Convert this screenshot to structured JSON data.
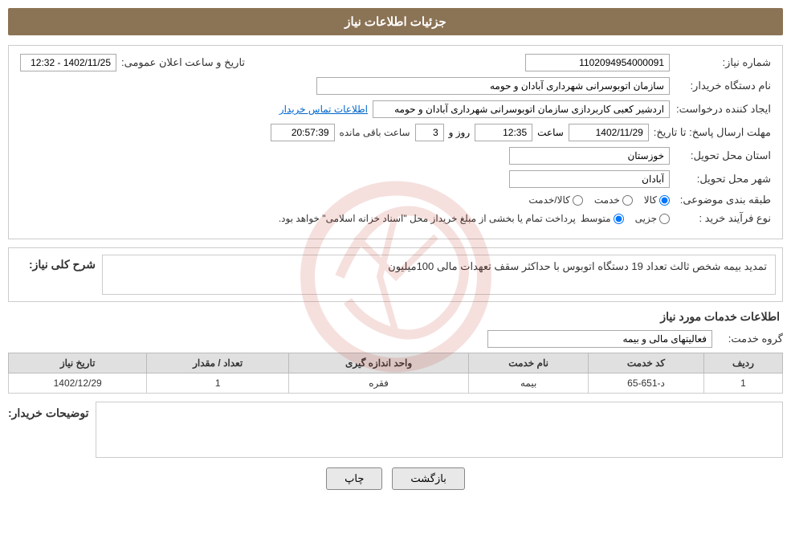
{
  "header": {
    "title": "جزئیات اطلاعات نیاز"
  },
  "fields": {
    "shomara_niaz_label": "شماره نیاز:",
    "shomara_niaz_value": "1102094954000091",
    "tarikh_label": "تاریخ و ساعت اعلان عمومی:",
    "tarikh_value": "1402/11/25 - 12:32",
    "nam_dastgah_label": "نام دستگاه خریدار:",
    "nam_dastgah_value": "سازمان اتوبوسرانی شهرداری آبادان و حومه",
    "ijad_label": "ایجاد کننده درخواست:",
    "ijad_value": "اردشیر کعبی کاربردازی سازمان اتوبوسرانی شهرداری آبادان و حومه",
    "etela_tamaslink": "اطلاعات تماس خریدار",
    "mohlat_label": "مهلت ارسال پاسخ: تا تاریخ:",
    "mohlat_date": "1402/11/29",
    "mohlat_time_label": "ساعت",
    "mohlat_time": "12:35",
    "mohlat_roz_label": "روز و",
    "mohlat_roz_value": "3",
    "mohlat_remaining_label": "ساعت باقی مانده",
    "mohlat_remaining_time": "20:57:39",
    "ostan_label": "استان محل تحویل:",
    "ostan_value": "خوزستان",
    "shahr_label": "شهر محل تحویل:",
    "shahr_value": "آبادان",
    "tabaqe_label": "طبقه بندی موضوعی:",
    "tabaqe_options": [
      {
        "label": "کالا",
        "value": "kala"
      },
      {
        "label": "خدمت",
        "value": "khedmat"
      },
      {
        "label": "کالا/خدمت",
        "value": "kala_khedmat"
      }
    ],
    "tabaqe_selected": "kala",
    "noeFarayan_label": "نوع فرآیند خرید :",
    "noeFarayan_options": [
      {
        "label": "جزیی",
        "value": "jozi"
      },
      {
        "label": "متوسط",
        "value": "motavaset"
      }
    ],
    "noeFarayan_selected": "motavaset",
    "payment_note": "پرداخت تمام یا بخشی از مبلغ خریداز محل \"اسناد خزانه اسلامی\" خواهد بود.",
    "sharh_label": "شرح کلی نیاز:",
    "sharh_value": "تمدید بیمه شخص ثالث تعداد 19 دستگاه اتوبوس\nبا حداکثر سقف تعهدات مالی 100میلیون",
    "services_title": "اطلاعات خدمات مورد نیاز",
    "grohe_khedmat_label": "گروه خدمت:",
    "grohe_khedmat_value": "فعالیتهای مالی و بیمه",
    "table": {
      "headers": [
        "ردیف",
        "کد خدمت",
        "نام خدمت",
        "واحد اندازه گیری",
        "تعداد / مقدار",
        "تاریخ نیاز"
      ],
      "rows": [
        {
          "radif": "1",
          "kod_khedmat": "د-651-65",
          "nam_khedmat": "بیمه",
          "vahed": "فقره",
          "tedad": "1",
          "tarikh": "1402/12/29"
        }
      ]
    },
    "buyer_desc_label": "توضیحات خریدار:",
    "buyer_desc_value": "",
    "btn_back": "بازگشت",
    "btn_print": "چاپ"
  }
}
